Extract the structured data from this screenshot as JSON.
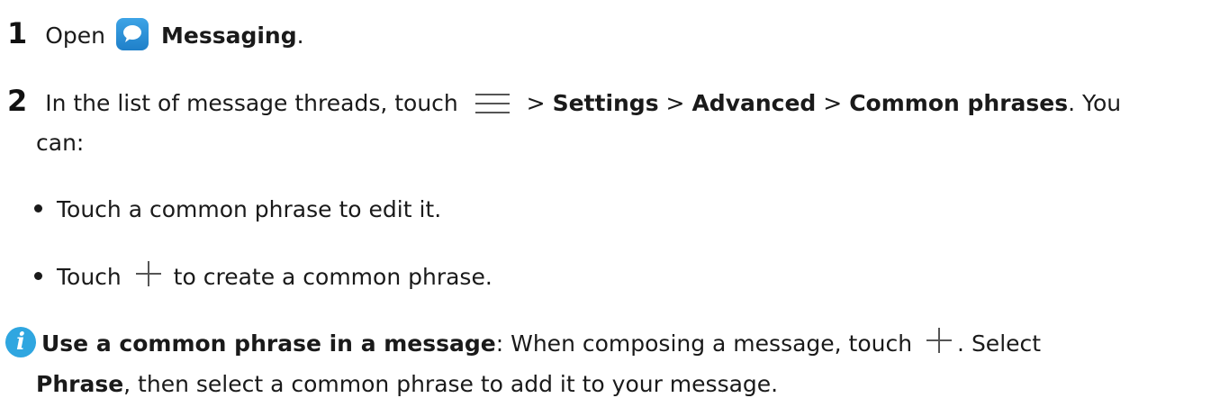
{
  "steps": [
    {
      "number": "1",
      "text_before": "Open",
      "app_name": "Messaging",
      "text_after": ".",
      "icon": "messaging-app-icon"
    },
    {
      "number": "2",
      "text_before": "In the list of message threads, touch",
      "menu_icon": "menu-icon",
      "sep1": ">",
      "settings": "Settings",
      "sep2": ">",
      "advanced": "Advanced",
      "sep3": ">",
      "common_phrases": "Common phrases",
      "text_after": ". You",
      "line2": "can:"
    }
  ],
  "bullets": [
    {
      "text": "Touch a common phrase to edit it."
    },
    {
      "text_before": "Touch",
      "icon": "plus-icon",
      "text_after": "to create a common phrase."
    }
  ],
  "note": {
    "icon": "info-icon",
    "heading": "Use a common phrase in a message",
    "text1": ": When composing a message, touch",
    "plus_icon": "plus-icon",
    "text2": ". Select",
    "phrase_label": "Phrase",
    "text3": ", then select a common phrase to add it to your message."
  },
  "colors": {
    "messaging_icon": "#2a8fd8",
    "info_icon": "#2fa6e0",
    "text": "#1a1a1a"
  }
}
